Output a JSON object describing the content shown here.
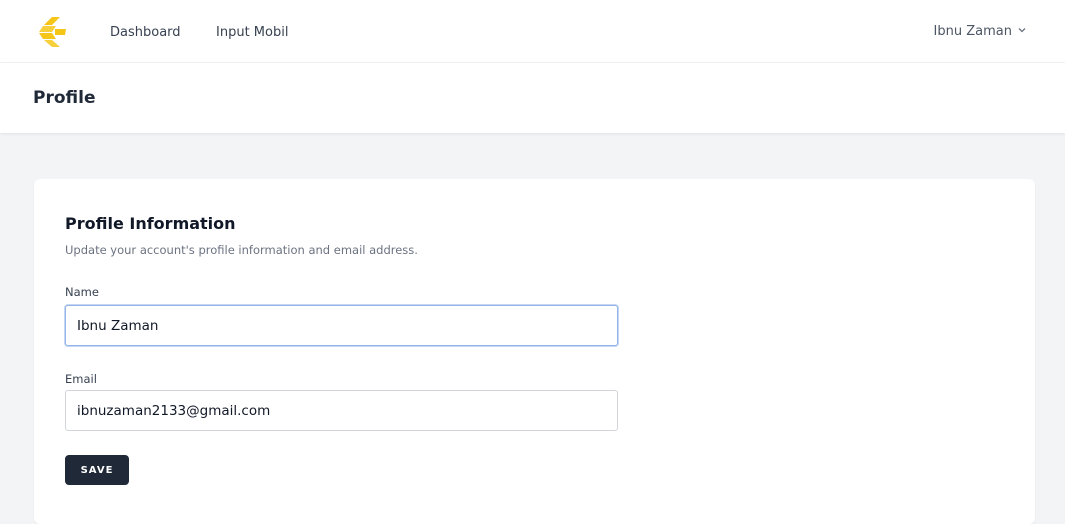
{
  "nav": {
    "logo_icon": "arrow-logo-icon",
    "links": [
      {
        "label": "Dashboard"
      },
      {
        "label": "Input Mobil"
      }
    ],
    "user_name": "Ibnu Zaman",
    "user_menu_icon": "chevron-down-icon"
  },
  "header": {
    "title": "Profile"
  },
  "profile_card": {
    "title": "Profile Information",
    "description": "Update your account's profile information and email address.",
    "name_label": "Name",
    "name_value": "Ibnu Zaman",
    "email_label": "Email",
    "email_value": "ibnuzaman2133@gmail.com",
    "save_label": "SAVE"
  },
  "colors": {
    "logo": "#f5c518",
    "button_bg": "#1f2937",
    "page_bg": "#f3f4f6",
    "focus_border": "#93b4e8"
  }
}
